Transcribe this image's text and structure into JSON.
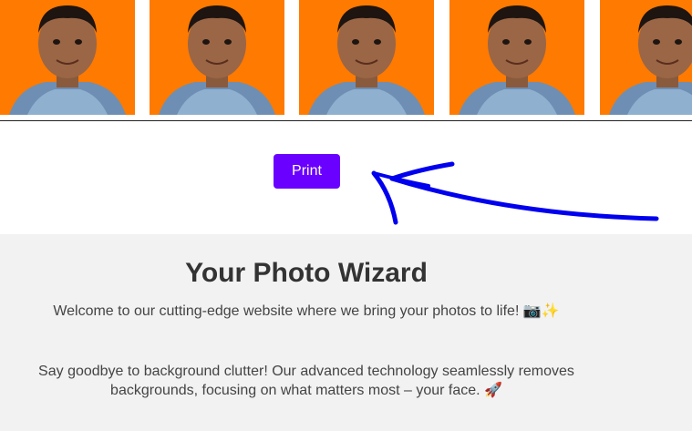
{
  "print": {
    "label": "Print"
  },
  "info": {
    "title": "Your Photo Wizard",
    "welcome": "Welcome to our cutting-edge website where we bring your photos to life! 📷✨",
    "description": "Say goodbye to background clutter! Our advanced technology seamlessly removes backgrounds, focusing on what matters most – your face. 🚀"
  },
  "colors": {
    "photo_background": "#ff7a00",
    "print_button": "#6a00ff",
    "annotation_arrow": "#0000ee",
    "info_background": "#f2f2f2"
  },
  "photos": [
    "passport-photo",
    "passport-photo",
    "passport-photo",
    "passport-photo",
    "passport-photo"
  ]
}
